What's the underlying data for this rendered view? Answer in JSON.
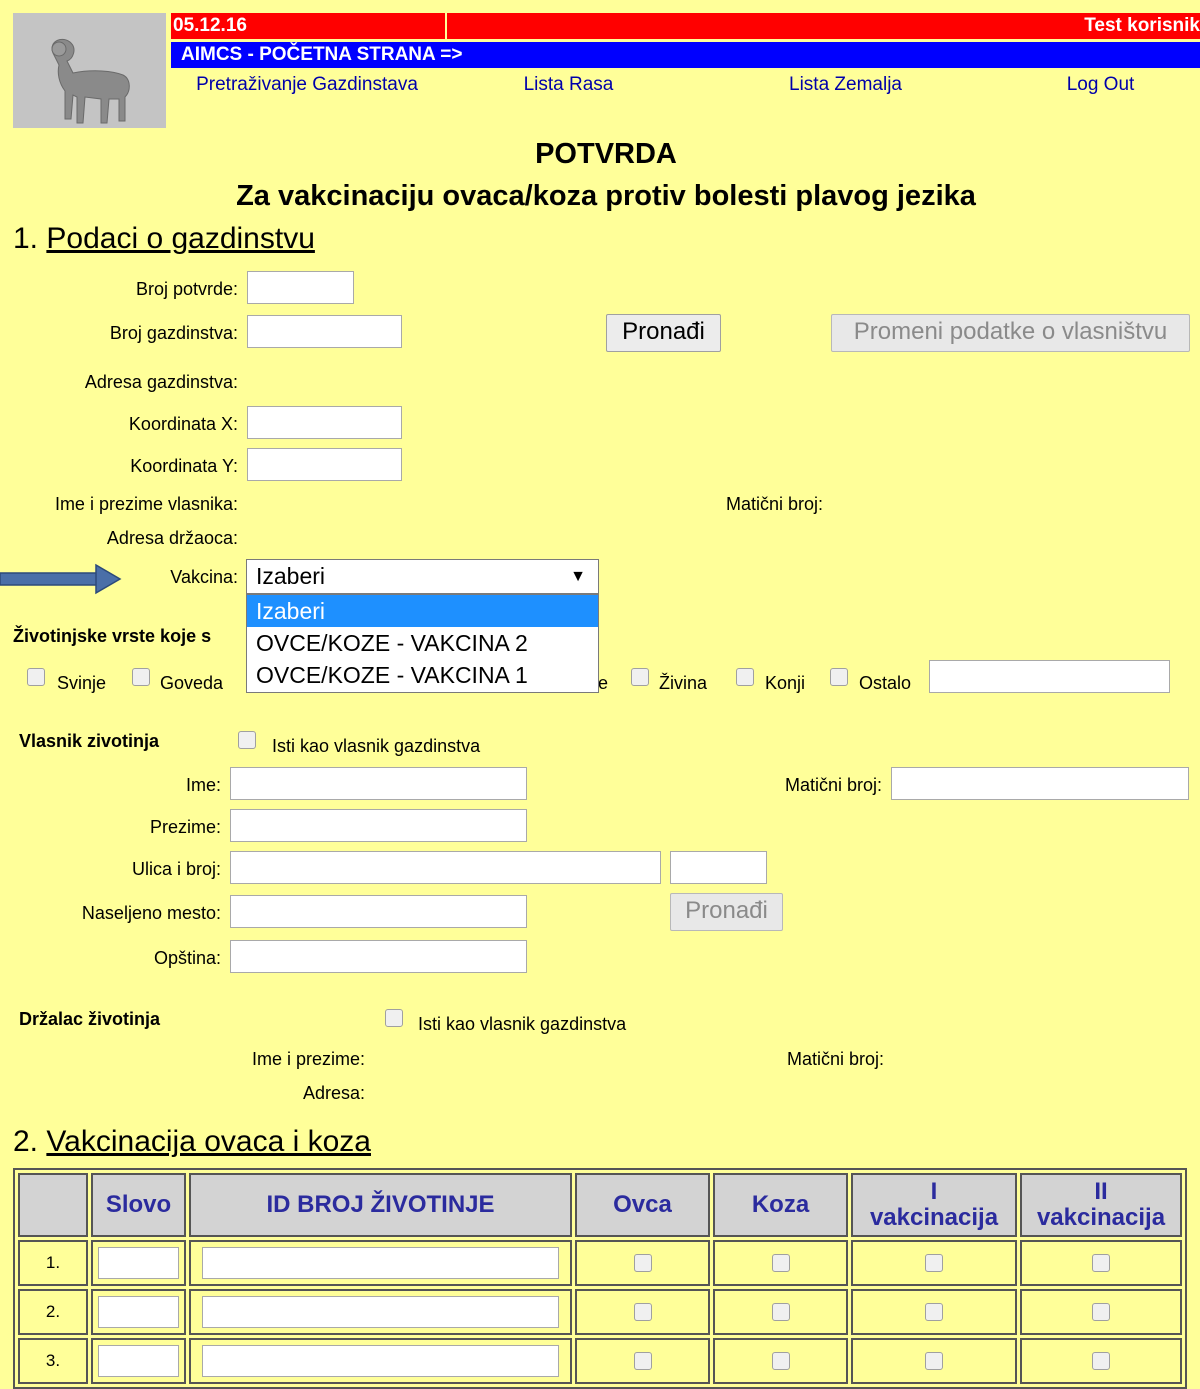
{
  "header": {
    "date": "05.12.16",
    "user": "Test korisnik",
    "home_link": "AIMCS - POČETNA STRANA =>",
    "nav": [
      {
        "label": "Pretraživanje Gazdinstava"
      },
      {
        "label": "Lista Rasa"
      },
      {
        "label": "Lista Zemalja"
      },
      {
        "label": "Log Out"
      }
    ]
  },
  "title": "POTVRDA",
  "subtitle": "Za vakcinaciju ovaca/koza protiv bolesti plavog jezika",
  "section1": {
    "number": "1.",
    "heading": "Podaci o gazdinstvu",
    "broj_potvrde_label": "Broj potvrde:",
    "broj_gazdinstva_label": "Broj gazdinstva:",
    "pronadji_button": "Pronađi",
    "promeni_button": "Promeni podatke o vlasništvu",
    "adresa_gazdinstva_label": "Adresa gazdinstva:",
    "koordinata_x_label": "Koordinata X:",
    "koordinata_y_label": "Koordinata Y:",
    "ime_prezime_vlasnika_label": "Ime i prezime vlasnika:",
    "maticni_broj_label": "Matični broj:",
    "adresa_drzaoca_label": "Adresa držaoca:",
    "vakcina_label": "Vakcina:",
    "vakcina_selected": "Izaberi",
    "vakcina_options": [
      "Izaberi",
      "OVCE/KOZE - VAKCINA 2",
      "OVCE/KOZE - VAKCINA 1"
    ],
    "species_label": "Životinjske vrste koje s",
    "species": {
      "svinje": "Svinje",
      "goveda": "Goveda",
      "hidden_suffix": "e",
      "zivina": "Živina",
      "konji": "Konji",
      "ostalo": "Ostalo"
    }
  },
  "vlasnik": {
    "heading": "Vlasnik zivotinja",
    "same_as_owner": "Isti kao vlasnik gazdinstva",
    "ime_label": "Ime:",
    "maticni_label": "Matični broj:",
    "prezime_label": "Prezime:",
    "ulica_label": "Ulica i broj:",
    "naselje_label": "Naseljeno mesto:",
    "pronadji_button": "Pronađi",
    "opstina_label": "Opština:"
  },
  "drzalac": {
    "heading": "Držalac životinja",
    "same_as_owner": "Isti kao vlasnik gazdinstva",
    "ime_label": "Ime i prezime:",
    "maticni_label": "Matični broj:",
    "adresa_label": "Adresa:"
  },
  "section2": {
    "number": "2.",
    "heading": "Vakcinacija ovaca i koza",
    "columns": [
      "Slovo",
      "ID BROJ ŽIVOTINJE",
      "Ovca",
      "Koza",
      "I",
      "vakcinacija",
      "II",
      "vakcinacija"
    ],
    "rows": [
      "1.",
      "2.",
      "3."
    ]
  },
  "colors": {
    "page_bg": "#ffff99",
    "red_bar": "#ff0000",
    "blue_bar": "#0000ff",
    "nav_text": "#0000aa",
    "dropdown_highlight": "#1e90ff",
    "arrow": "#3a5f9e"
  }
}
